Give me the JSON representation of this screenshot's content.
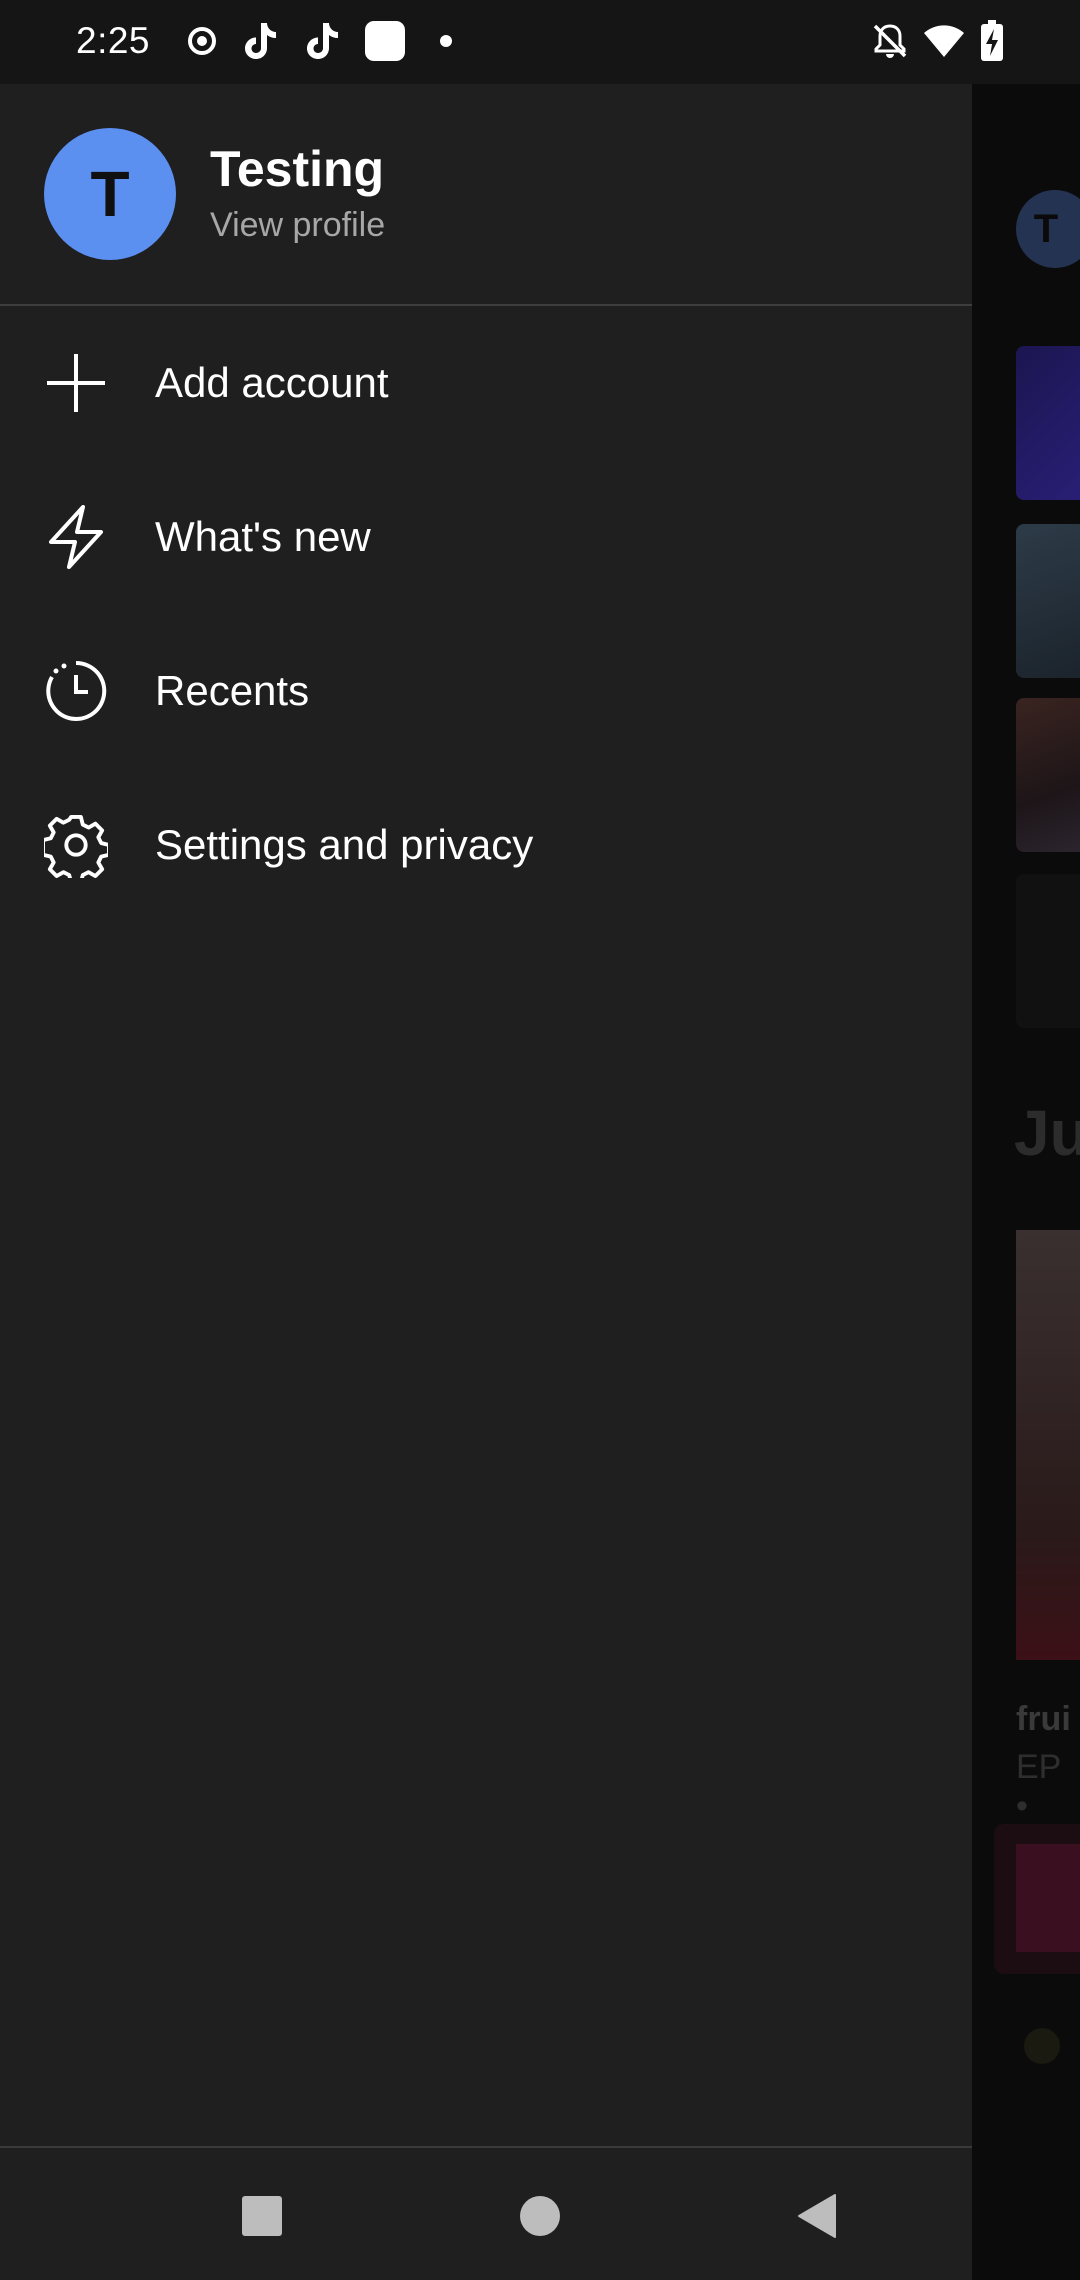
{
  "status_bar": {
    "time": "2:25",
    "left_icons": [
      "record-icon",
      "tiktok-icon",
      "tiktok-icon",
      "app-square-icon",
      "dot-icon"
    ],
    "right_icons": [
      "bell-off-icon",
      "wifi-icon",
      "battery-charging-icon"
    ]
  },
  "drawer": {
    "profile": {
      "initial": "T",
      "name": "Testing",
      "link": "View profile",
      "avatar_color": "#5b8ff0"
    },
    "menu": [
      {
        "label": "Add account",
        "icon": "plus-icon"
      },
      {
        "label": "What's new",
        "icon": "lightning-icon"
      },
      {
        "label": "Recents",
        "icon": "clock-icon"
      },
      {
        "label": "Settings and privacy",
        "icon": "gear-icon"
      }
    ]
  },
  "background_app": {
    "avatar_initial": "T",
    "section_heading": "Ju",
    "item_title": "frui",
    "item_subtitle": "EP •"
  },
  "nav_bar": {
    "buttons": [
      "recents-square-icon",
      "home-circle-icon",
      "back-triangle-icon"
    ]
  }
}
